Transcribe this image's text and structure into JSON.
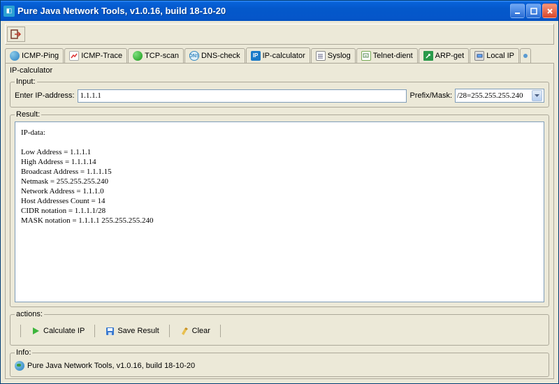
{
  "window": {
    "title": "Pure Java Network Tools,  v1.0.16, build 18-10-20"
  },
  "tabs": [
    {
      "label": "ICMP-Ping",
      "active": false
    },
    {
      "label": "ICMP-Trace",
      "active": false
    },
    {
      "label": "TCP-scan",
      "active": false
    },
    {
      "label": "DNS-check",
      "active": false
    },
    {
      "label": "IP-calculator",
      "active": true
    },
    {
      "label": "Syslog",
      "active": false
    },
    {
      "label": "Telnet-dient",
      "active": false
    },
    {
      "label": "ARP-get",
      "active": false
    },
    {
      "label": "Local IP",
      "active": false
    }
  ],
  "panel": {
    "legend": "IP-calculator",
    "input": {
      "legend": "Input:",
      "label": "Enter IP-address:",
      "value": "1.1.1.1",
      "prefix_label": "Prefix/Mask:",
      "prefix_value": "/28=255.255.255.240"
    },
    "result": {
      "legend": "Result:",
      "text": "IP-data:\n\nLow Address = 1.1.1.1\nHigh Address = 1.1.1.14\nBroadcast Address = 1.1.1.15\nNetmask = 255.255.255.240\nNetwork Address = 1.1.1.0\nHost Addresses Count = 14\nCIDR notation = 1.1.1.1/28\nMASK notation = 1.1.1.1 255.255.255.240"
    },
    "actions": {
      "legend": "actions:",
      "calculate": "Calculate IP",
      "save": "Save Result",
      "clear": "Clear"
    },
    "info": {
      "legend": "Info:",
      "text": "Pure Java Network Tools,  v1.0.16, build 18-10-20"
    }
  }
}
